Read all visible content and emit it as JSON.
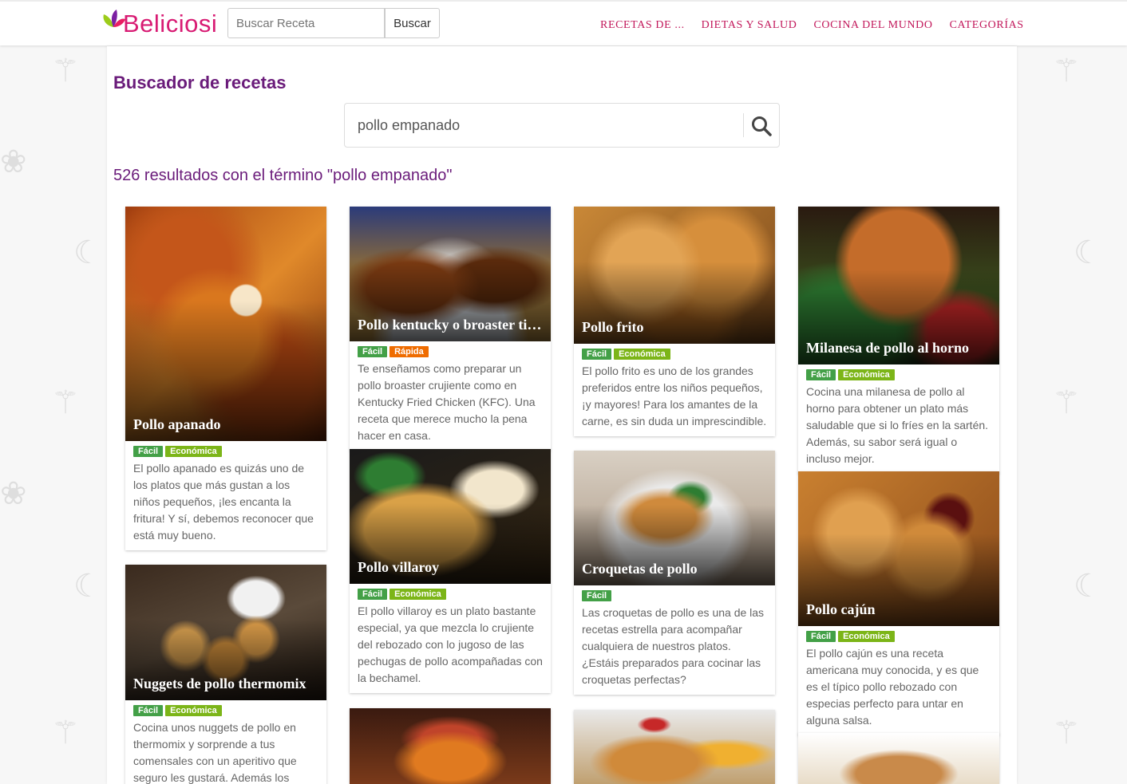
{
  "brand": {
    "name": "Beliciosi",
    "color": "#d81b73"
  },
  "topbar": {
    "search_placeholder": "Buscar Receta",
    "search_button": "Buscar",
    "nav": [
      "RECETAS DE ...",
      "DIETAS Y SALUD",
      "COCINA DEL MUNDO",
      "CATEGORÍAS"
    ]
  },
  "main": {
    "title": "Buscador de recetas",
    "query": "pollo empanado",
    "results_text": "526 resultados con el término \"pollo empanado\""
  },
  "cards": [
    {
      "title": "Pollo apanado",
      "tags": [
        "Fácil",
        "Económica"
      ],
      "description": "El pollo apanado es quizás uno de los platos que más gustan a los niños pequeños, ¡les encanta la fritura! Y sí, debemos reconocer que está muy bueno."
    },
    {
      "title": "Nuggets de pollo thermomix",
      "tags": [
        "Fácil",
        "Económica"
      ],
      "description": "Cocina unos nuggets de pollo en thermomix y sorprende a tus comensales con un aperitivo que seguro les gustará. Además los"
    },
    {
      "title": "Pollo kentucky o broaster tipo KFC",
      "tags": [
        "Fácil",
        "Rápida"
      ],
      "description": "Te enseñamos como preparar un pollo broaster crujiente como en Kentucky Fried Chicken (KFC). Una receta que merece mucho la pena hacer en casa."
    },
    {
      "title": "Pollo villaroy",
      "tags": [
        "Fácil",
        "Económica"
      ],
      "description": "El pollo villaroy es un plato bastante especial, ya que mezcla lo crujiente del rebozado con lo jugoso de las pechugas de pollo acompañadas con la bechamel."
    },
    {
      "title": "Pollo frito",
      "tags": [
        "Fácil",
        "Económica"
      ],
      "description": "El pollo frito es uno de los grandes preferidos entre los niños pequeños, ¡y mayores! Para los amantes de la carne, es sin duda un imprescindible."
    },
    {
      "title": "Croquetas de pollo",
      "tags": [
        "Fácil"
      ],
      "description": "Las croquetas de pollo es una de las recetas estrella para acompañar cualquiera de nuestros platos. ¿Estáis preparados para cocinar las croquetas perfectas?"
    },
    {
      "title": "Milanesa de pollo al horno",
      "tags": [
        "Fácil",
        "Económica"
      ],
      "description": "Cocina una milanesa de pollo al horno para obtener un plato más saludable que si lo fríes en la sartén. Además, su sabor será igual o incluso mejor."
    },
    {
      "title": "Pollo cajún",
      "tags": [
        "Fácil",
        "Económica"
      ],
      "description": "El pollo cajún es una receta americana muy conocida, y es que es el típico pollo rebozado con especias perfecto para untar en alguna salsa."
    }
  ],
  "tag_colors": {
    "Fácil": "#43a047",
    "Económica": "#7cb518",
    "Rápida": "#ef6c00"
  }
}
